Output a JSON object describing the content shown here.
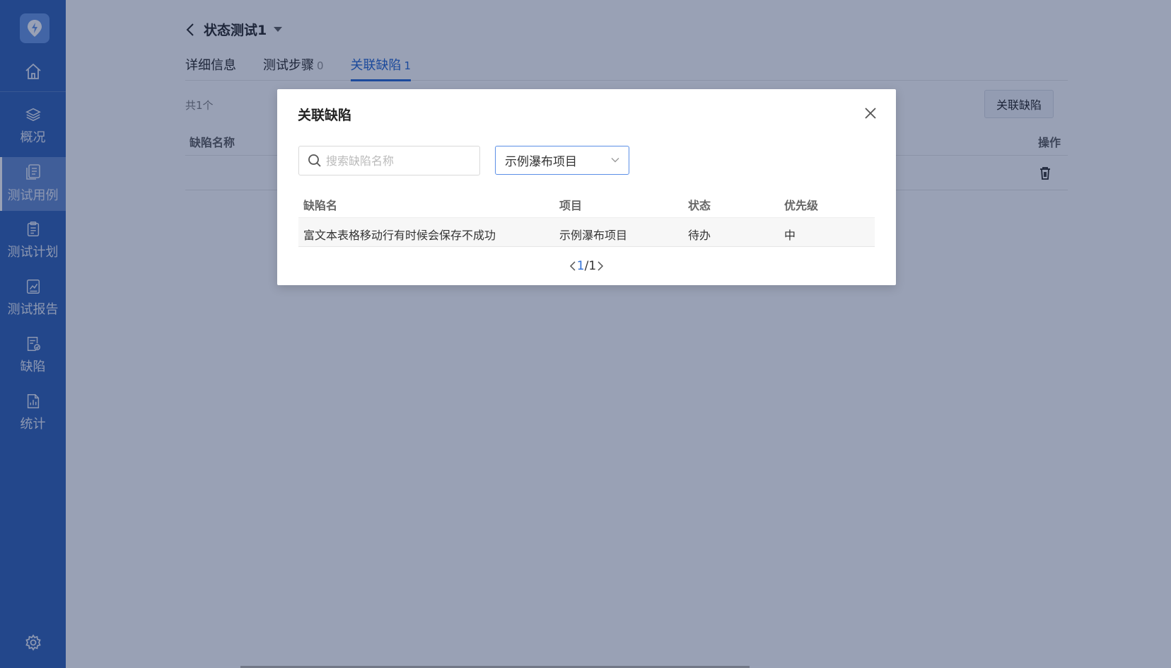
{
  "sidebar": {
    "items": [
      {
        "label": "",
        "icon": "home-icon"
      },
      {
        "label": "概况",
        "icon": "layers-icon"
      },
      {
        "label": "测试用例",
        "icon": "copy-icon",
        "active": true
      },
      {
        "label": "测试计划",
        "icon": "clipboard-icon"
      },
      {
        "label": "测试报告",
        "icon": "chart-report-icon"
      },
      {
        "label": "缺陷",
        "icon": "bug-doc-icon"
      },
      {
        "label": "统计",
        "icon": "stats-doc-icon"
      }
    ],
    "settings_icon": "gear-icon"
  },
  "page": {
    "title": "状态测试1",
    "tabs": [
      {
        "label": "详细信息",
        "count": ""
      },
      {
        "label": "测试步骤",
        "count": "0"
      },
      {
        "label": "关联缺陷",
        "count": "1",
        "active": true
      }
    ],
    "total_text": "共1个",
    "link_button_label": "关联缺陷",
    "table_headers": {
      "name": "缺陷名称",
      "action": "操作"
    }
  },
  "modal": {
    "title": "关联缺陷",
    "search_placeholder": "搜索缺陷名称",
    "project_select_value": "示例瀑布项目",
    "columns": [
      "缺陷名",
      "项目",
      "状态",
      "优先级"
    ],
    "rows": [
      [
        "富文本表格移动行有时候会保存不成功",
        "示例瀑布项目",
        "待办",
        "中"
      ]
    ],
    "pager": {
      "current": "1",
      "separator": "/",
      "total": " 1"
    }
  },
  "colors": {
    "sidebar": "#3b69b9",
    "accent": "#2f6fd6"
  }
}
